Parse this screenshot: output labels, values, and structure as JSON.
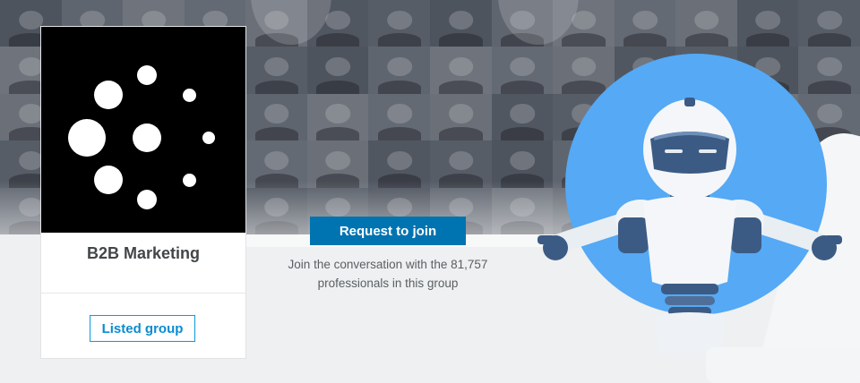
{
  "group": {
    "name": "B2B Marketing",
    "listed_label": "Listed group"
  },
  "cta": {
    "join_label": "Request to join",
    "description": "Join the conversation with the 81,757 professionals in this group"
  },
  "colors": {
    "primary": "#0073b1",
    "link": "#0a8ccf",
    "robot_bg": "#55a9f5",
    "banner": "#5a606b"
  },
  "icons": {
    "logo": "dots-circle-logo",
    "illustration": "robot-mascot"
  }
}
